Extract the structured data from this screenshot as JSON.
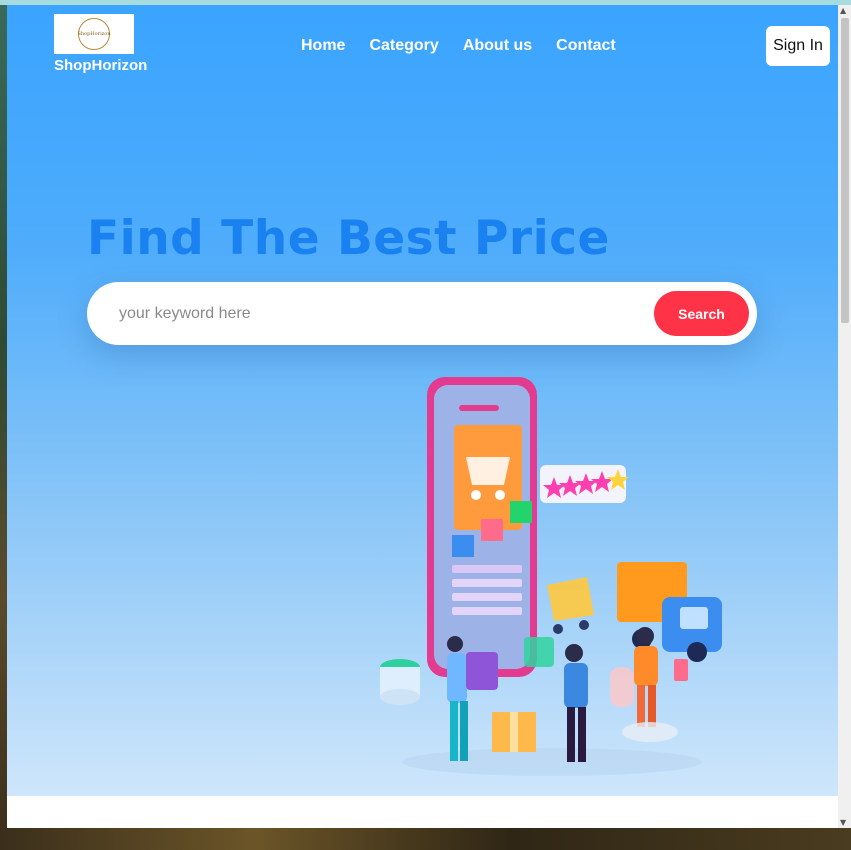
{
  "brand": {
    "name": "ShopHorizon",
    "logo_text": "ShopHorizon"
  },
  "nav": {
    "items": [
      {
        "label": "Home"
      },
      {
        "label": "Category"
      },
      {
        "label": "About us"
      },
      {
        "label": "Contact"
      }
    ]
  },
  "header": {
    "signin_label": "Sign In"
  },
  "hero": {
    "title": "Find The Best Price",
    "search": {
      "placeholder": "your keyword here",
      "value": "",
      "button_label": "Search"
    }
  },
  "colors": {
    "hero_top": "#3aa4ff",
    "hero_bottom": "#cfe6fb",
    "headline": "#1a82f0",
    "search_button": "#ff3347"
  },
  "illustration": {
    "icon": "online-shopping-illustration-icon"
  }
}
